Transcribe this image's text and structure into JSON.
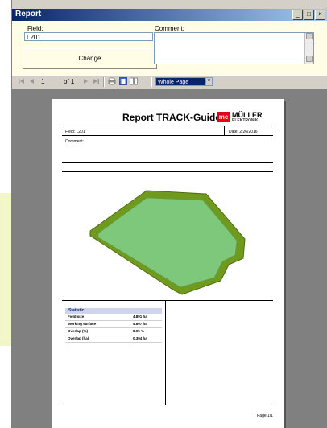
{
  "window": {
    "title": "Report",
    "minimize": "_",
    "maximize": "□",
    "close": "×"
  },
  "form": {
    "field_label": "Field:",
    "field_value": "L201",
    "comment_label": "Comment:",
    "comment_value": "",
    "change_button": "Change"
  },
  "toolbar": {
    "page_current": "1",
    "page_of": "of 1",
    "zoom_value": "Whole Page"
  },
  "report": {
    "title": "Report TRACK-Guide",
    "logo_mark": "me",
    "logo_name": "MÜLLER",
    "logo_sub": "ELEKTRONIK",
    "field_text": "Field: L201",
    "date_text": "Date: 2/26/2016",
    "comment_text": "Comment:",
    "stats_title": "Statistic",
    "stats": [
      {
        "label": "Field size",
        "value": "4.891 ha"
      },
      {
        "label": "Working surface",
        "value": "4.897 ha"
      },
      {
        "label": "Overlap (%)",
        "value": "8.05 %"
      },
      {
        "label": "Overlap (ha)",
        "value": "0.394 ha"
      }
    ],
    "page_label": "Page 1/1"
  },
  "colors": {
    "field_fill": "#79c36a",
    "field_border": "#6a8a14",
    "title_bar": "#0a246a",
    "form_bg": "#fffde6"
  }
}
